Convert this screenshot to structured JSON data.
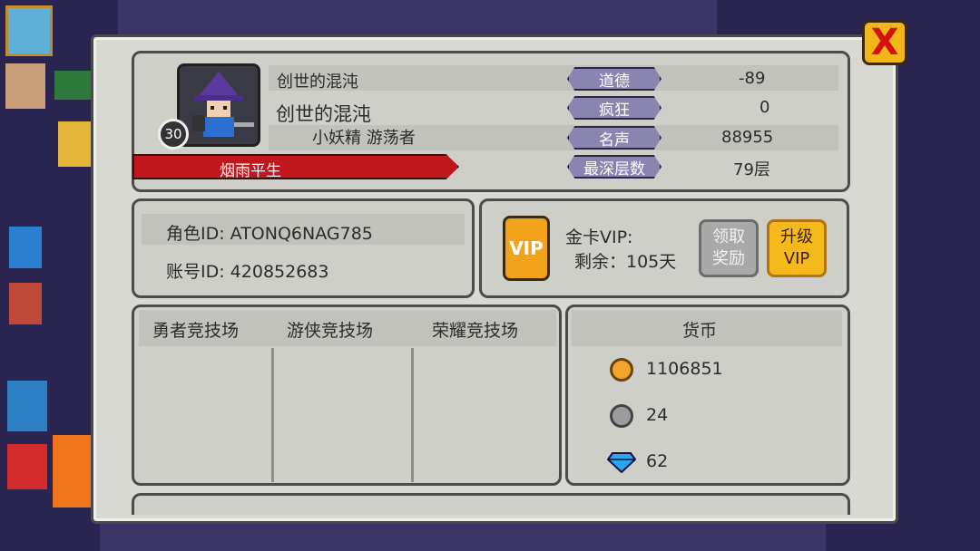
{
  "close_label": "X",
  "profile": {
    "header_name": "创世的混沌",
    "name": "创世的混沌",
    "subtitle": "小妖精  游荡者",
    "level": "30",
    "title_banner": "烟雨平生"
  },
  "stats": [
    {
      "label": "道德",
      "value": "-89"
    },
    {
      "label": "疯狂",
      "value": "0"
    },
    {
      "label": "名声",
      "value": "88955"
    },
    {
      "label": "最深层数",
      "value": "79层"
    }
  ],
  "ids": {
    "role_id": "角色ID: ATONQ6NAG785",
    "account_id": "账号ID: 420852683"
  },
  "vip": {
    "icon_text": "VIP",
    "line1": "金卡VIP:",
    "line2": "剩余：105天",
    "claim_line1": "领取",
    "claim_line2": "奖励",
    "upgrade_line1": "升级",
    "upgrade_line2": "VIP"
  },
  "arenas": [
    "勇者竞技场",
    "游侠竞技场",
    "荣耀竞技场"
  ],
  "currency": {
    "title": "货币",
    "items": [
      {
        "icon": "gold-coin-icon",
        "value": "1106851"
      },
      {
        "icon": "silver-coin-icon",
        "value": "24"
      },
      {
        "icon": "gem-icon",
        "value": "62"
      }
    ]
  },
  "colors": {
    "accent_gold": "#f4b519",
    "banner_red": "#c0161c",
    "stat_purple": "#8a84b0"
  }
}
